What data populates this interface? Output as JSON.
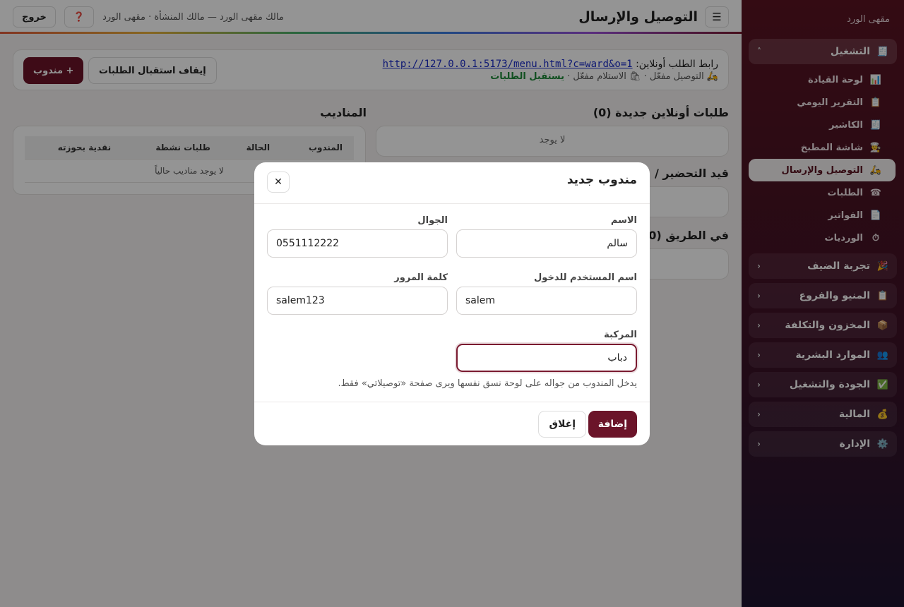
{
  "header": {
    "title": "التوصيل والإرسال",
    "subtitle": "مالك مقهى الورد — مالك المنشأة · مقهى الورد",
    "help_icon": "❓",
    "logout_label": "خروج",
    "menu_icon": "☰"
  },
  "sidebar": {
    "brand": "مقهى الورد",
    "groups": [
      {
        "label": "التشغيل",
        "icon": "🧾",
        "chevron": "˄"
      },
      {
        "label": "تجربة الضيف",
        "icon": "🎉",
        "chevron": "‹"
      },
      {
        "label": "المنيو والفروع",
        "icon": "📋",
        "chevron": "‹"
      },
      {
        "label": "المخزون والتكلفة",
        "icon": "📦",
        "chevron": "‹"
      },
      {
        "label": "الموارد البشرية",
        "icon": "👥",
        "chevron": "‹"
      },
      {
        "label": "الجودة والتشغيل",
        "icon": "✅",
        "chevron": "‹"
      },
      {
        "label": "المالية",
        "icon": "💰",
        "chevron": "‹"
      },
      {
        "label": "الإدارة",
        "icon": "⚙️",
        "chevron": "‹"
      }
    ],
    "items": [
      {
        "label": "لوحة القيادة",
        "icon": "📊"
      },
      {
        "label": "التقرير اليومي",
        "icon": "📋"
      },
      {
        "label": "الكاشير",
        "icon": "🧾"
      },
      {
        "label": "شاشة المطبخ",
        "icon": "👨‍🍳"
      },
      {
        "label": "التوصيل والإرسال",
        "icon": "🛵"
      },
      {
        "label": "الطلبات",
        "icon": "☎"
      },
      {
        "label": "الفواتير",
        "icon": "📄"
      },
      {
        "label": "الورديات",
        "icon": "⏱"
      }
    ]
  },
  "main": {
    "link_label": "رابط الطلب أونلاين:",
    "link_url": "http://127.0.0.1:5173/menu.html?c=ward&o=1",
    "status_prefix": "🛵 التوصيل مفعّل · 🛍 الاستلام مفعّل ·",
    "status_accepting": "يستقبل الطلبات",
    "add_driver_label": "+ مندوب",
    "stop_orders_label": "إيقاف استقبال الطلبات",
    "new_orders_title": "طلبات أونلاين جديدة (0)",
    "new_orders_empty": "لا يوجد",
    "preparing_title": "قيد التحضير / جاهز",
    "on_the_way_title": "في الطريق (0)",
    "drivers_title": "المناديب",
    "drivers_columns": [
      "المندوب",
      "الحالة",
      "طلبات نشطة",
      "نقدية بحوزته"
    ],
    "drivers_empty": "لا يوجد مناديب حالياً"
  },
  "modal": {
    "title": "مندوب جديد",
    "close_icon": "✕",
    "name_label": "الاسم",
    "name_value": "سالم",
    "phone_label": "الجوال",
    "phone_value": "0551112222",
    "username_label": "اسم المستخدم للدخول",
    "username_value": "salem",
    "password_label": "كلمة المرور",
    "password_value": "salem123",
    "vehicle_label": "المركبة",
    "vehicle_value": "دباب",
    "hint": "يدخل المندوب من جواله على لوحة نسق نفسها ويرى صفحة «توصيلاتي» فقط.",
    "add_label": "إضافة",
    "cancel_label": "إغلاق"
  },
  "colors": {
    "brand": "#6b1429",
    "success": "#1f8a3a",
    "link": "#1a2cc8"
  }
}
